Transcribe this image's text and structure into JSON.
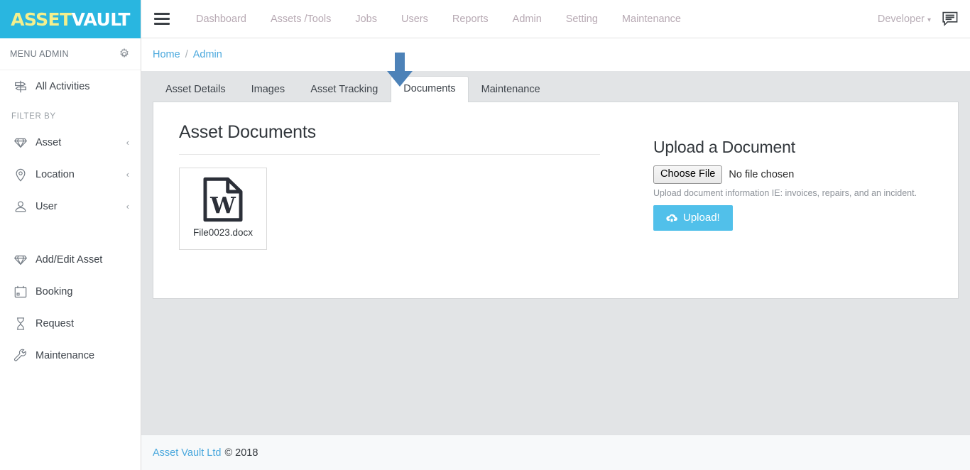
{
  "brand": {
    "logo_part1": "ASSET",
    "logo_part2": "VAULT",
    "logo_bg": "#29b6e0",
    "logo_color1": "#f3ef8d",
    "logo_color2": "#ffffff"
  },
  "sidebar": {
    "menu_admin_label": "MENU ADMIN",
    "gear_icon": "gear-icon",
    "primary": [
      {
        "label": "All Activities",
        "icon": "signpost-icon"
      }
    ],
    "filter_by_label": "FILTER BY",
    "filters": [
      {
        "label": "Asset",
        "icon": "diamond-icon",
        "chevron": "‹"
      },
      {
        "label": "Location",
        "icon": "map-pin-icon",
        "chevron": "‹"
      },
      {
        "label": "User",
        "icon": "user-icon",
        "chevron": "‹"
      }
    ],
    "actions": [
      {
        "label": "Add/Edit Asset",
        "icon": "diamond-icon"
      },
      {
        "label": "Booking",
        "icon": "calendar-icon"
      },
      {
        "label": "Request",
        "icon": "hourglass-icon"
      },
      {
        "label": "Maintenance",
        "icon": "wrench-icon"
      }
    ]
  },
  "topbar": {
    "hamburger_icon": "hamburger-icon",
    "nav_items": [
      "Dashboard",
      "Assets /Tools",
      "Jobs",
      "Users",
      "Reports",
      "Admin",
      "Setting",
      "Maintenance"
    ],
    "user_menu_label": "Developer",
    "user_menu_caret": "▾",
    "message_icon": "message-bubble-icon"
  },
  "breadcrumb": {
    "items": [
      "Home",
      "Admin"
    ],
    "separator": "/"
  },
  "tabs": {
    "items": [
      {
        "label": "Asset Details",
        "active": false
      },
      {
        "label": "Images",
        "active": false
      },
      {
        "label": "Asset Tracking",
        "active": false
      },
      {
        "label": "Documents",
        "active": true
      },
      {
        "label": "Maintenance",
        "active": false
      }
    ],
    "active_label": "Documents"
  },
  "annotation": {
    "arrow": "down-arrow-annotation",
    "color": "#4d82b8",
    "points_to": "Documents"
  },
  "documents": {
    "title": "Asset Documents",
    "files": [
      {
        "name": "File0023.docx",
        "icon": "word-file-icon"
      }
    ]
  },
  "upload": {
    "title": "Upload a Document",
    "choose_file_label": "Choose File",
    "no_file_text": "No file chosen",
    "help_text": "Upload document information IE: invoices, repairs, and an incident.",
    "upload_button_label": "Upload!",
    "upload_button_icon": "cloud-upload-icon",
    "upload_button_color": "#51c0ea"
  },
  "footer": {
    "link": "Asset Vault Ltd",
    "copyright": "© 2018"
  }
}
